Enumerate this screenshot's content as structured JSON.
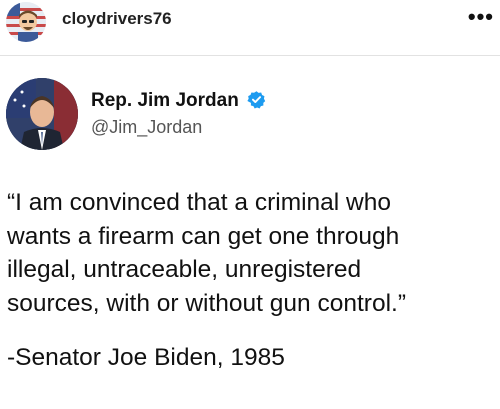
{
  "post": {
    "username": "cloydrivers76",
    "more_icon": "more-horizontal-icon",
    "more_glyph": "•••"
  },
  "tweet": {
    "author_name": "Rep. Jim Jordan",
    "author_handle": "@Jim_Jordan",
    "verified_icon": "verified-badge-icon",
    "verified_color": "#1d9bf0",
    "quote_text": "“I am convinced that a criminal who\nwants a firearm can get one through\nillegal, untraceable, unregistered\nsources, with or without gun control.”",
    "attribution": "-Senator Joe Biden, 1985"
  }
}
